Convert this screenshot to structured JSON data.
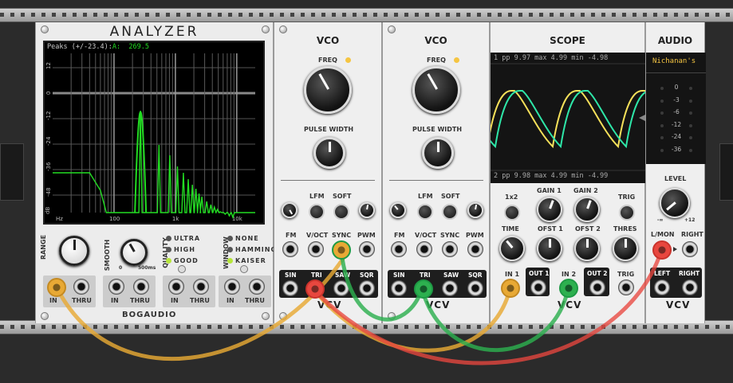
{
  "analyzer": {
    "title": "ANALYZER",
    "readout_peaks": "Peaks (+/-23.4):",
    "readout_channel": "A:",
    "readout_value": "269.5",
    "y_ticks": [
      "12",
      "0",
      "-12",
      "-24",
      "-36",
      "-48",
      "dB"
    ],
    "x_ticks": [
      "Hz",
      "100",
      "1k",
      "10k"
    ],
    "range_label": "RANGE",
    "smooth_label": "SMOOTH",
    "smooth_min": "0",
    "smooth_max": "500ms",
    "quality_label": "QUALITY",
    "quality_options": [
      "ULTRA",
      "HIGH",
      "GOOD"
    ],
    "window_label": "WINDOW",
    "window_options": [
      "NONE",
      "HAMMING",
      "KAISER"
    ],
    "in_label": "IN",
    "thru_label": "THRU",
    "brand": "BOGAUDIO",
    "colors": {
      "trace": "#22dd22",
      "screen": "#000000",
      "readout": "#22dd22"
    }
  },
  "vco1": {
    "title": "VCO",
    "freq_label": "FREQ",
    "pulse_width_label": "PULSE WIDTH",
    "lfm": "LFM",
    "soft": "SOFT",
    "fm": "FM",
    "voct": "V/OCT",
    "sync": "SYNC",
    "pwm": "PWM",
    "sin": "SIN",
    "tri": "TRI",
    "saw": "SAW",
    "sqr": "SQR",
    "brand": "VCV"
  },
  "vco2": {
    "title": "VCO",
    "freq_label": "FREQ",
    "pulse_width_label": "PULSE WIDTH",
    "lfm": "LFM",
    "soft": "SOFT",
    "fm": "FM",
    "voct": "V/OCT",
    "sync": "SYNC",
    "pwm": "PWM",
    "sin": "SIN",
    "tri": "TRI",
    "saw": "SAW",
    "sqr": "SQR",
    "brand": "VCV"
  },
  "scope": {
    "title": "SCOPE",
    "top_readout": "1  pp   9.97 max  4.99 min -4.98",
    "bottom_readout": "2  pp   9.98 max  4.99 min -4.99",
    "x2": "1x2",
    "gain1": "GAIN 1",
    "gain2": "GAIN 2",
    "trig": "TRIG",
    "time": "TIME",
    "ofst1": "OFST 1",
    "ofst2": "OFST 2",
    "thres": "THRES",
    "in1": "IN 1",
    "out1": "OUT 1",
    "in2": "IN 2",
    "out2": "OUT 2",
    "trig_in": "TRIG",
    "brand": "VCV",
    "colors": {
      "trace1": "#f5e05a",
      "trace2": "#2ee6a8"
    }
  },
  "audio": {
    "title": "AUDIO",
    "device": "Nichanan's",
    "meter_ticks": [
      "0",
      "-3",
      "-6",
      "-12",
      "-24",
      "-36"
    ],
    "level_label": "LEVEL",
    "level_min": "-∞",
    "level_max": "+12",
    "lmon": "L/MON",
    "right": "RIGHT",
    "left": "LEFT",
    "right2": "RIGHT",
    "brand": "VCV"
  },
  "cables": {
    "orange": "#e8a935",
    "red": "#e8473f",
    "green": "#2db04f"
  }
}
